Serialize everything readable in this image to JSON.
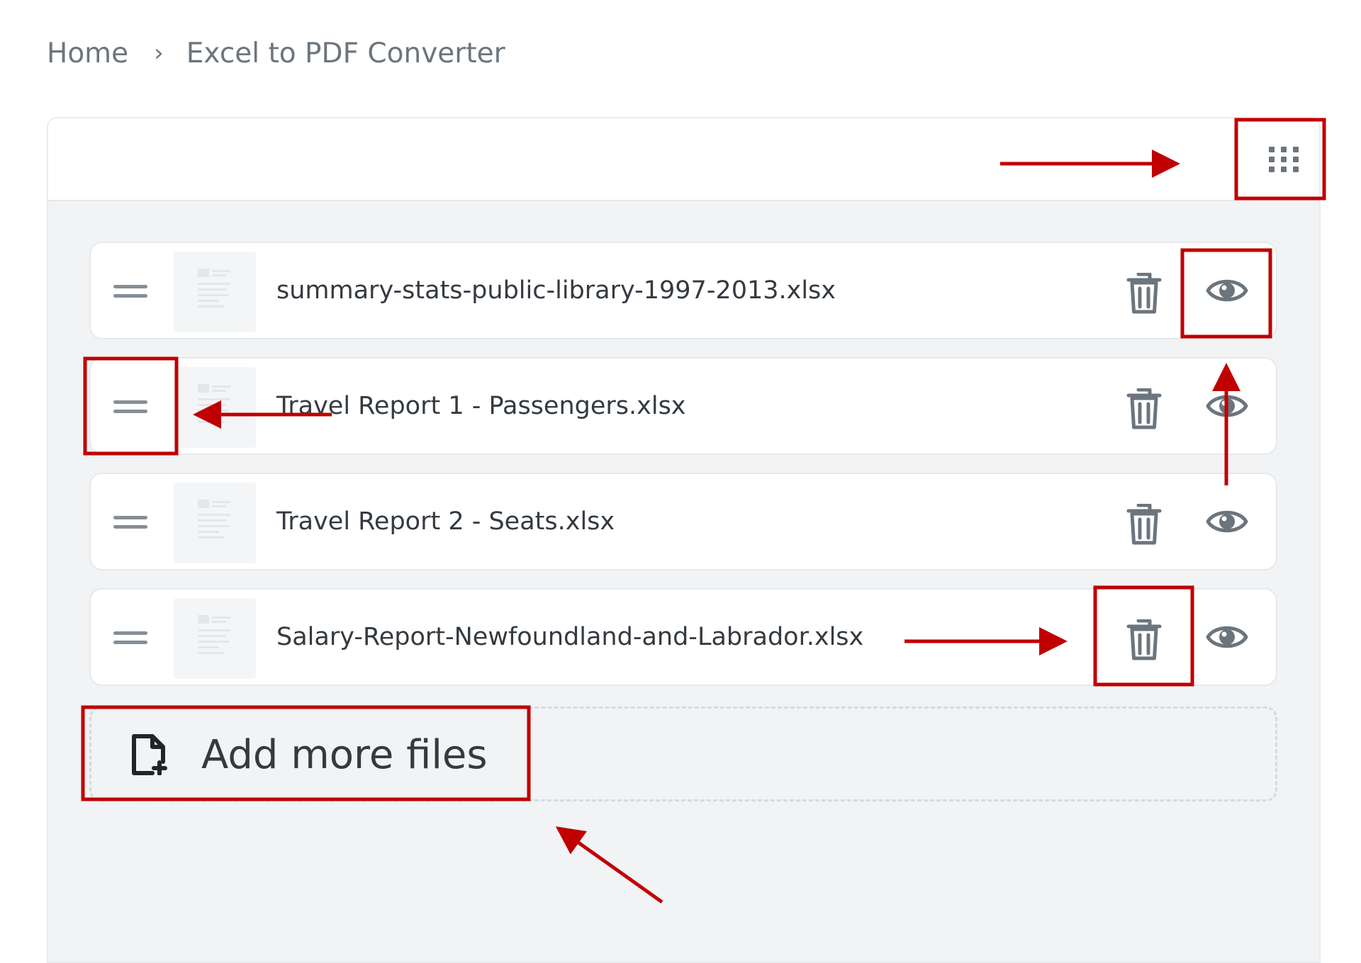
{
  "breadcrumb": {
    "home": "Home",
    "separator": "›",
    "current": "Excel to PDF Converter"
  },
  "toolbar": {
    "grid_icon": "grid-view-icon"
  },
  "files": [
    {
      "name": "summary-stats-public-library-1997-2013.xlsx"
    },
    {
      "name": "Travel Report 1 - Passengers.xlsx"
    },
    {
      "name": "Travel Report 2 - Seats.xlsx"
    },
    {
      "name": "Salary-Report-Newfoundland-and-Labrador.xlsx"
    }
  ],
  "add_files": {
    "label": "Add more files",
    "icon": "file-add-icon"
  },
  "annotation_color": "#c00000"
}
